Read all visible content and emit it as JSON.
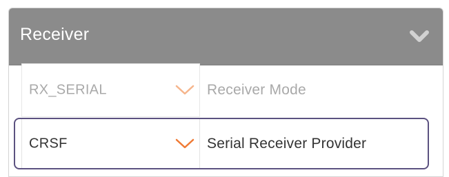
{
  "panel": {
    "title": "Receiver",
    "header_color": "#8b8b8b",
    "collapse_icon": "chevron-down-icon"
  },
  "rows": [
    {
      "select_value": "RX_SERIAL",
      "label": "Receiver Mode",
      "state": "disabled"
    },
    {
      "select_value": "CRSF",
      "label": "Serial Receiver Provider",
      "state": "focused"
    }
  ],
  "colors": {
    "accent_arrow": "#f07a34",
    "focus_ring": "#5b5180",
    "disabled_text": "#a9a9a9"
  }
}
